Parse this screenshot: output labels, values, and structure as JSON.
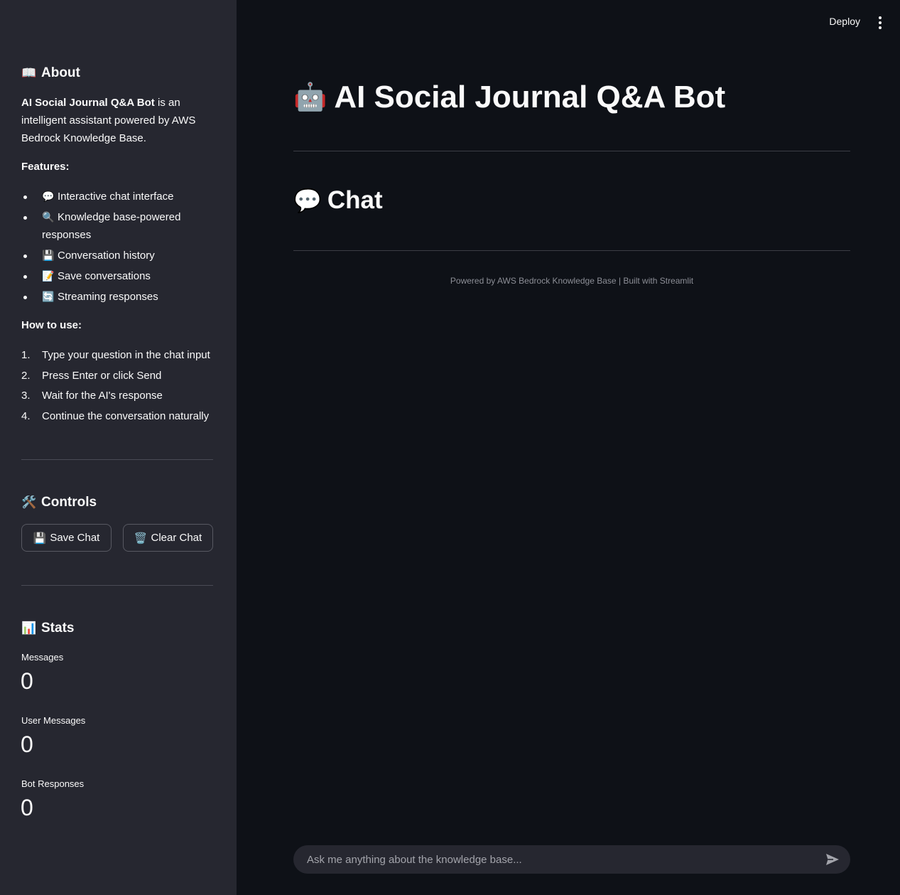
{
  "header": {
    "deploy_label": "Deploy",
    "menu_icon": "vertical-dots-icon"
  },
  "sidebar": {
    "about": {
      "emoji": "📖",
      "title": "About",
      "app_name": "AI Social Journal Q&A Bot",
      "description": " is an intelligent assistant powered by AWS Bedrock Knowledge Base."
    },
    "features": {
      "label": "Features:",
      "items": [
        {
          "emoji": "💬",
          "text": "Interactive chat interface"
        },
        {
          "emoji": "🔍",
          "text": "Knowledge base-powered responses"
        },
        {
          "emoji": "💾",
          "text": "Conversation history"
        },
        {
          "emoji": "📝",
          "text": "Save conversations"
        },
        {
          "emoji": "🔄",
          "text": "Streaming responses"
        }
      ]
    },
    "how_to": {
      "label": "How to use:",
      "steps": [
        {
          "num": "1.",
          "text": "Type your question in the chat input"
        },
        {
          "num": "2.",
          "text": "Press Enter or click Send"
        },
        {
          "num": "3.",
          "text": "Wait for the AI's response"
        },
        {
          "num": "4.",
          "text": "Continue the conversation naturally"
        }
      ]
    },
    "controls": {
      "emoji": "🛠️",
      "title": "Controls",
      "save_emoji": "💾",
      "save_label": "Save Chat",
      "clear_emoji": "🗑️",
      "clear_label": "Clear Chat"
    },
    "stats": {
      "emoji": "📊",
      "title": "Stats",
      "metrics": [
        {
          "label": "Messages",
          "value": "0"
        },
        {
          "label": "User Messages",
          "value": "0"
        },
        {
          "label": "Bot Responses",
          "value": "0"
        }
      ]
    }
  },
  "main": {
    "title_emoji": "🤖",
    "title": "AI Social Journal Q&A Bot",
    "chat_emoji": "💬",
    "chat_heading": "Chat",
    "footer": "Powered by AWS Bedrock Knowledge Base | Built with Streamlit",
    "chat_input": {
      "placeholder": "Ask me anything about the knowledge base...",
      "value": "",
      "send_icon": "send-icon"
    }
  },
  "colors": {
    "sidebar_bg": "#262730",
    "main_bg": "#0e1117",
    "text": "#fafafa",
    "muted_text": "#8c8e96"
  }
}
